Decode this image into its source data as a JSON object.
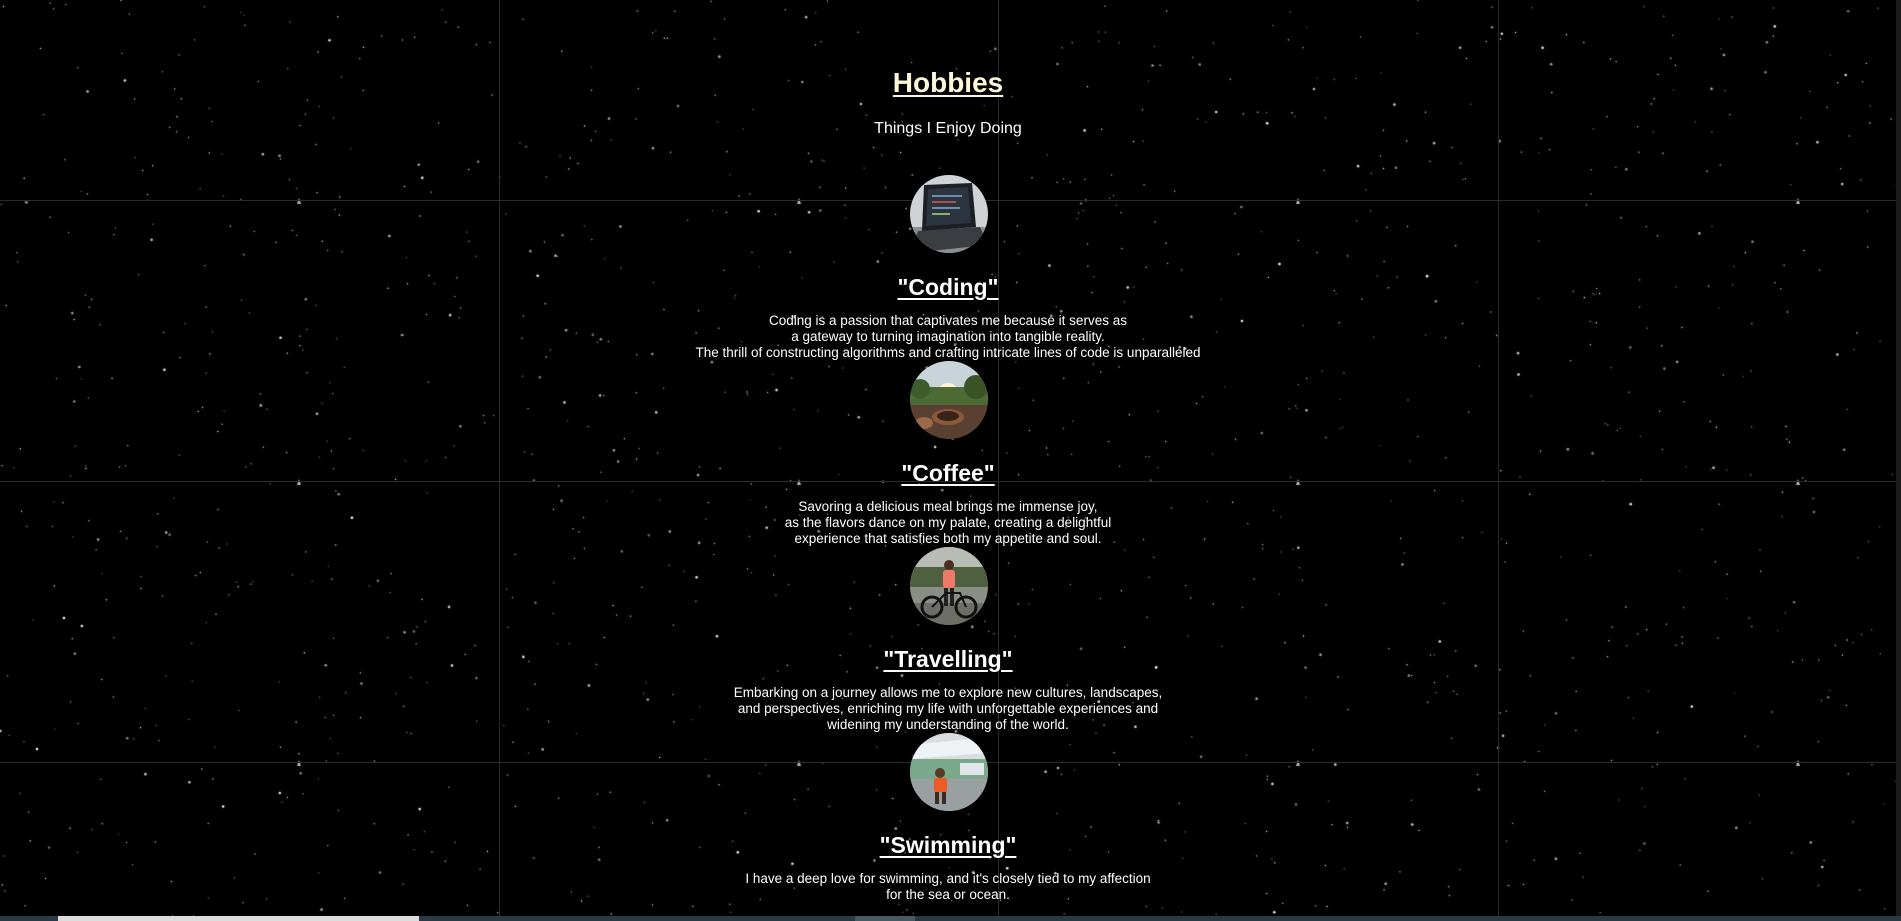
{
  "header": {
    "title": "Hobbies",
    "subtitle": "Things I Enjoy Doing"
  },
  "hobbies": [
    {
      "title": "\"Coding\"",
      "image_icon": "laptop-photo",
      "lines": [
        "Coding is a passion that captivates me because it serves as",
        "a gateway to turning imagination into tangible reality.",
        "The thrill of constructing algorithms and crafting intricate lines of code is unparalleled"
      ]
    },
    {
      "title": "\"Coffee\"",
      "image_icon": "coffee-photo",
      "lines": [
        "Savoring a delicious meal brings me immense joy,",
        "as the flavors dance on my palate, creating a delightful",
        "experience that satisfies both my appetite and soul."
      ]
    },
    {
      "title": "\"Travelling\"",
      "image_icon": "bicycle-photo",
      "lines": [
        "Embarking on a journey allows me to explore new cultures, landscapes,",
        "and perspectives, enriching my life with unforgettable experiences and",
        "widening my understanding of the world."
      ]
    },
    {
      "title": "\"Swimming\"",
      "image_icon": "swimming-photo",
      "lines": [
        "I have a deep love for swimming, and it's closely tied to my affection",
        "for the sea or ocean."
      ]
    }
  ],
  "colors": {
    "background": "#000000",
    "title": "#fdf6d8",
    "text": "#ffffff",
    "grid": "#2b2b2b"
  }
}
